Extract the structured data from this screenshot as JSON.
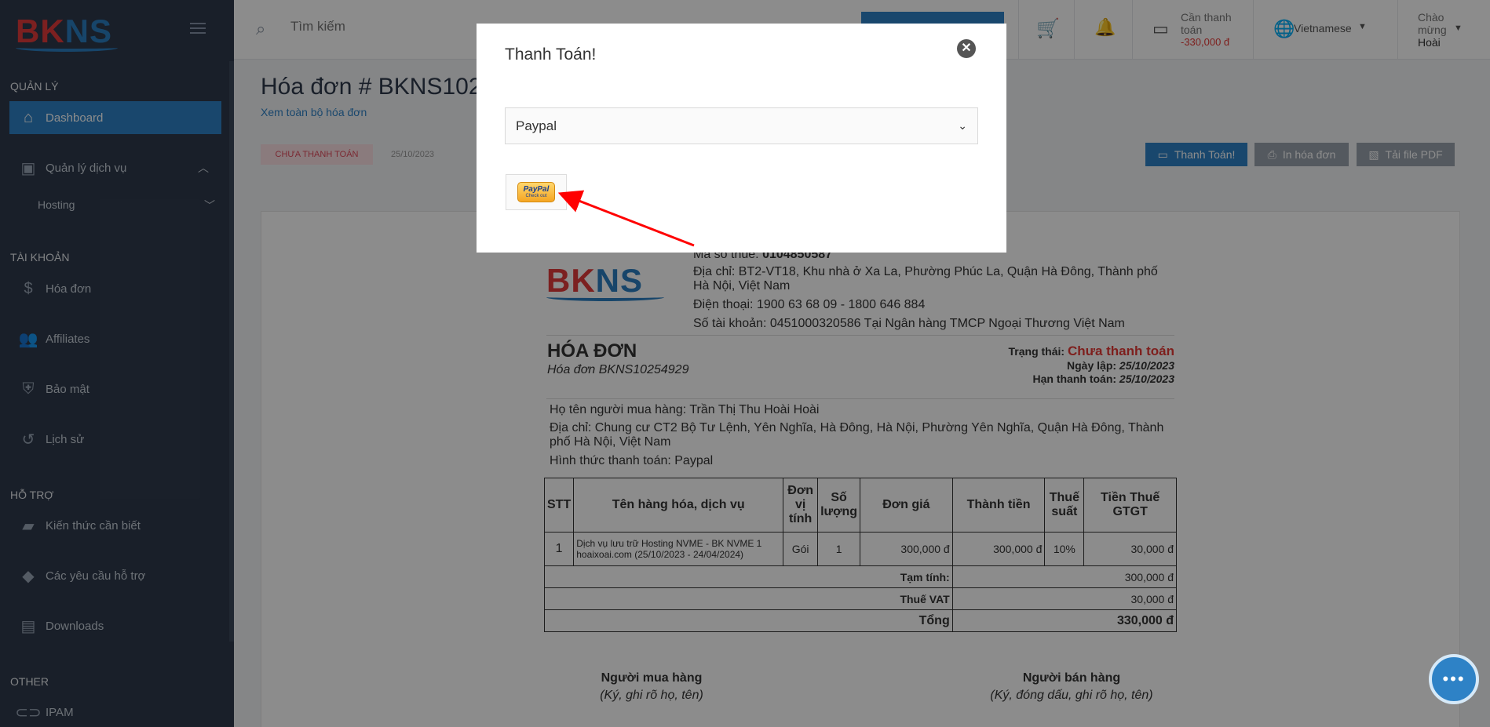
{
  "sidebar": {
    "logo_main": "BK",
    "logo_accent": "NS",
    "sections": {
      "manage": "QUẢN LÝ",
      "account": "TÀI KHOẢN",
      "support": "HỖ TRỢ",
      "other": "OTHER"
    },
    "items": {
      "dashboard": "Dashboard",
      "services": "Quản lý dịch vụ",
      "hosting": "Hosting",
      "invoices": "Hóa đơn",
      "affiliates": "Affiliates",
      "security": "Bảo mật",
      "history": "Lịch sử",
      "knowledge": "Kiến thức cần biết",
      "tickets": "Các yêu cầu hỗ trợ",
      "downloads": "Downloads",
      "ipam": "IPAM"
    }
  },
  "topbar": {
    "search_placeholder": "Tìm kiếm",
    "wallet_label": "Cần thanh toán",
    "wallet_amount": "-330,000 đ",
    "language": "Vietnamese",
    "greeting": "Chào mừng",
    "user": "Hoài"
  },
  "page": {
    "title": "Hóa đơn # BKNS102",
    "view_all": "Xem toàn bộ hóa đơn",
    "status_badge": "CHƯA THANH TOÁN",
    "date": "25/10/2023",
    "btn_pay": "Thanh Toán!",
    "btn_print": "In hóa đơn",
    "btn_pdf": "Tải file PDF"
  },
  "invoice": {
    "logo_main": "BK",
    "logo_accent": "NS",
    "tax_code_label": "Mã số thuế:",
    "tax_code": "0104850587",
    "address": "Địa chỉ: BT2-VT18, Khu nhà ở Xa La, Phường Phúc La, Quận Hà Đông, Thành phố Hà Nội, Việt Nam",
    "phone": "Điện thoại: 1900 63 68 09 - 1800 646 884",
    "bank": "Số tài khoản: 0451000320586 Tại Ngân hàng TMCP Ngoại Thương Việt Nam",
    "heading": "HÓA ĐƠN",
    "number": "Hóa đơn BKNS10254929",
    "status_label": "Trạng thái:",
    "status_value": "Chưa thanh toán",
    "issue_label": "Ngày lập:",
    "issue_date": "25/10/2023",
    "due_label": "Hạn thanh toán:",
    "due_date": "25/10/2023",
    "buyer_name": "Họ tên người mua hàng: Trần Thị Thu Hoài Hoài",
    "buyer_address": "Địa chỉ: Chung cư CT2 Bộ Tư Lệnh, Yên Nghĩa, Hà Đông, Hà Nội, Phường Yên Nghĩa, Quận Hà Đông, Thành phố Hà Nội, Việt Nam",
    "payment_method": "Hình thức thanh toán: Paypal",
    "columns": {
      "stt": "STT",
      "name": "Tên hàng hóa, dịch vụ",
      "unit": "Đơn vị tính",
      "qty": "Số lượng",
      "price": "Đơn giá",
      "amount": "Thành tiền",
      "tax": "Thuế suất",
      "vat": "Tiền Thuế GTGT"
    },
    "row": {
      "stt": "1",
      "name": "Dịch vụ lưu trữ Hosting NVME - BK NVME 1 hoaixoai.com (25/10/2023 - 24/04/2024)",
      "unit": "Gói",
      "qty": "1",
      "price": "300,000 đ",
      "amount": "300,000 đ",
      "tax": "10%",
      "vat": "30,000 đ"
    },
    "subtotal_label": "Tạm tính:",
    "subtotal": "300,000 đ",
    "vat_label": "Thuế VAT",
    "vat_total": "30,000 đ",
    "total_label": "Tổng",
    "total": "330,000 đ",
    "buyer_sign": "Người mua hàng",
    "buyer_sign_note": "(Ký, ghi rõ họ, tên)",
    "seller_sign": "Người bán hàng",
    "seller_sign_note": "(Ký, đóng dấu, ghi rõ họ, tên)"
  },
  "modal": {
    "title": "Thanh Toán!",
    "selected_method": "Paypal",
    "paypal_label": "PayPal",
    "paypal_sub": "Check out"
  },
  "colors": {
    "sidebar_bg": "#2f3a4c",
    "accent": "#2e82c6",
    "danger": "#e53935",
    "annotation_arrow": "#ff0000"
  },
  "icons": {
    "search": "search-icon",
    "cart": "cart-icon",
    "bell": "bell-icon",
    "wallet": "wallet-icon",
    "globe": "globe-icon",
    "close": "close-icon",
    "chat": "chat-icon"
  }
}
